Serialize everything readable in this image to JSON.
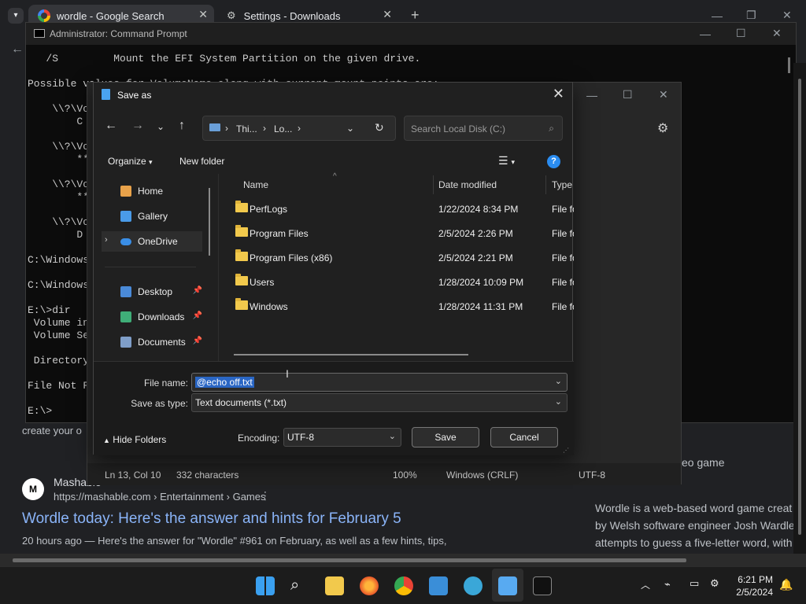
{
  "browser": {
    "tabs": [
      {
        "label": "wordle - Google Search"
      },
      {
        "label": "Settings - Downloads"
      }
    ],
    "new_tab": "+"
  },
  "google": {
    "result_site": "Mashable",
    "result_url": "https://mashable.com › Entertainment › Games",
    "result_title": "Wordle today: Here's the answer and hints for February 5",
    "result_snippet": "20 hours ago — Here's the answer for \"Wordle\" #961 on February, as well as a few hints, tips,",
    "side_snippet_top": "eo game",
    "side_snippet": [
      "Wordle is a web-based word game creat",
      "by Welsh software engineer Josh Wardle",
      "attempts to guess a five-letter word, with"
    ],
    "left_fragment": "create your o"
  },
  "cmd": {
    "title": "Administrator: Command Prompt",
    "lines": [
      "   /S         Mount the EFI System Partition on the given drive.",
      "",
      "Possible values for VolumeName along with current mount points are:",
      "",
      "    \\\\?\\Vo",
      "        C",
      "",
      "    \\\\?\\Vo",
      "        **",
      "",
      "    \\\\?\\Vo",
      "        **",
      "",
      "    \\\\?\\Vo",
      "        D",
      "",
      "C:\\Windows",
      "",
      "C:\\Windows",
      "",
      "E:\\>dir",
      " Volume in",
      " Volume Se",
      "",
      " Directory",
      "",
      "File Not F",
      "",
      "E:\\>"
    ]
  },
  "notepad": {
    "status": {
      "position": "Ln 13, Col 10",
      "chars": "332 characters",
      "zoom": "100%",
      "line_ending": "Windows (CRLF)",
      "encoding": "UTF-8"
    }
  },
  "dialog": {
    "title": "Save as",
    "breadcrumb": [
      "Thi...",
      "Lo..."
    ],
    "search_placeholder": "Search Local Disk (C:)",
    "toolbar": {
      "organize": "Organize",
      "new_folder": "New folder"
    },
    "nav": [
      {
        "label": "Home"
      },
      {
        "label": "Gallery"
      },
      {
        "label": "OneDrive"
      },
      {
        "label": "Desktop"
      },
      {
        "label": "Downloads"
      },
      {
        "label": "Documents"
      }
    ],
    "columns": {
      "name": "Name",
      "date": "Date modified",
      "type": "Type"
    },
    "files": [
      {
        "name": "PerfLogs",
        "date": "1/22/2024 8:34 PM",
        "type": "File fo"
      },
      {
        "name": "Program Files",
        "date": "2/5/2024 2:26 PM",
        "type": "File fo"
      },
      {
        "name": "Program Files (x86)",
        "date": "2/5/2024 2:21 PM",
        "type": "File fo"
      },
      {
        "name": "Users",
        "date": "1/28/2024 10:09 PM",
        "type": "File fo"
      },
      {
        "name": "Windows",
        "date": "1/28/2024 11:31 PM",
        "type": "File fo"
      }
    ],
    "file_name_label": "File name:",
    "file_name_value": "@echo off.txt",
    "save_type_label": "Save as type:",
    "save_type_value": "Text documents (*.txt)",
    "hide_folders": "Hide Folders",
    "encoding_label": "Encoding:",
    "encoding_value": "UTF-8",
    "save_button": "Save",
    "cancel_button": "Cancel"
  },
  "taskbar": {
    "time": "6:21 PM",
    "date": "2/5/2024"
  }
}
